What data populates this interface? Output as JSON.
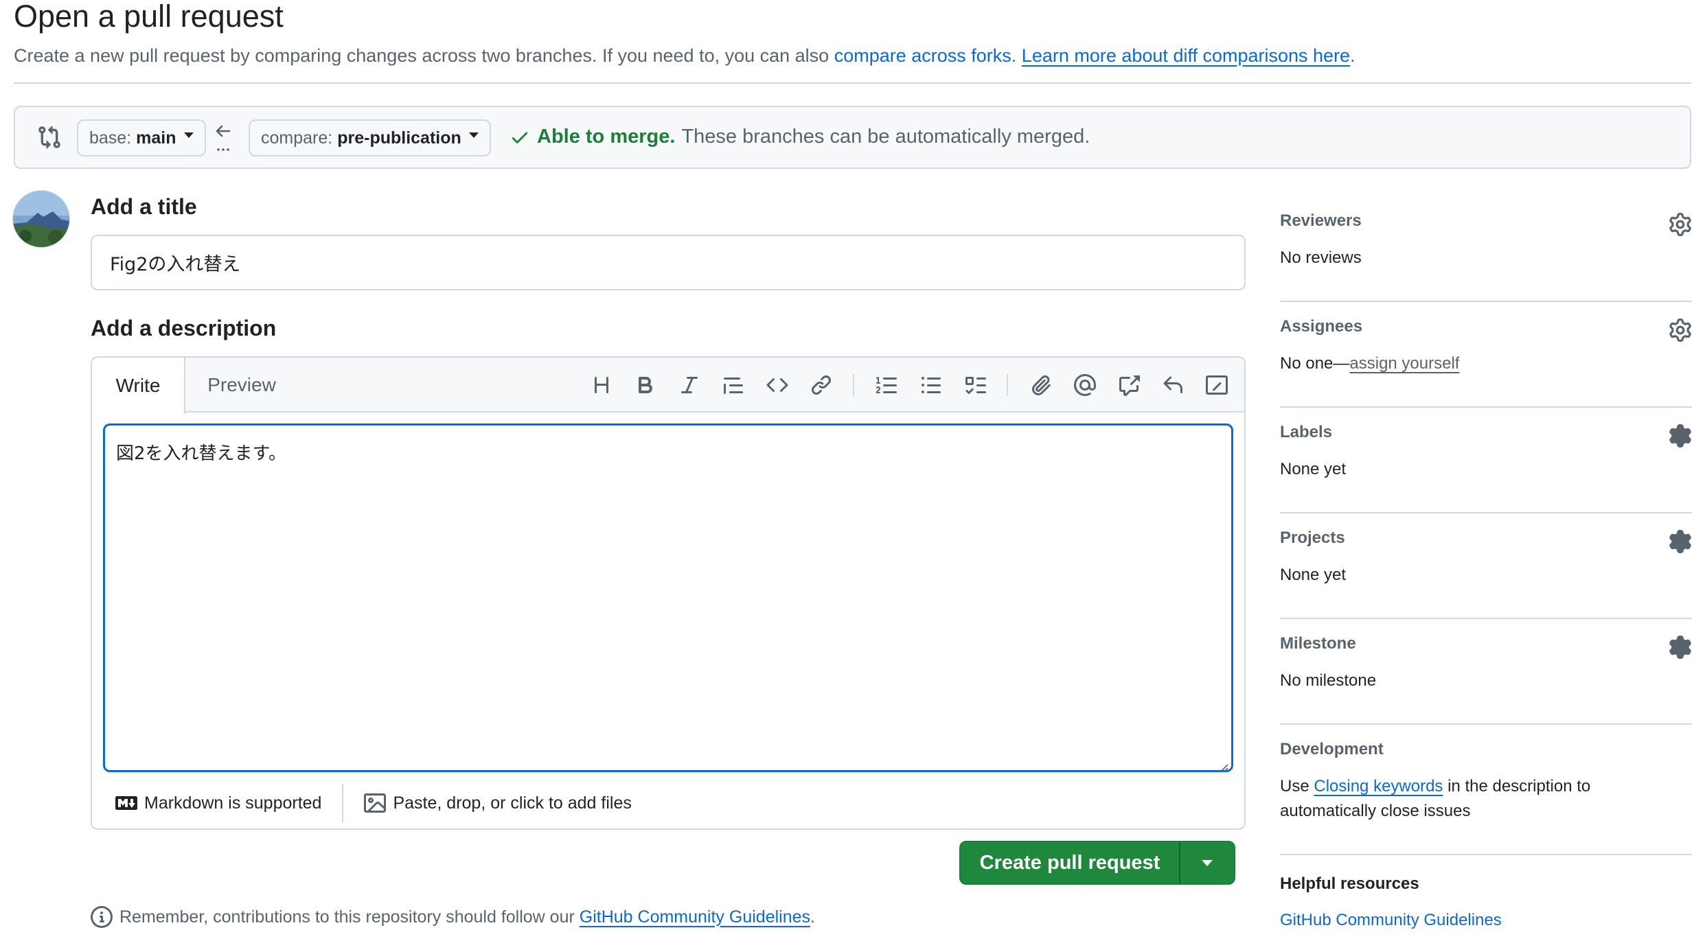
{
  "header": {
    "title": "Open a pull request",
    "subtitle_text": "Create a new pull request by comparing changes across two branches. If you need to, you can also ",
    "compare_forks_link": "compare across forks",
    "learn_more_link": "Learn more about diff comparisons here"
  },
  "compare": {
    "base_label": "base:",
    "base_value": "main",
    "compare_label": "compare:",
    "compare_value": "pre-publication",
    "merge_ok": "Able to merge.",
    "merge_msg": "These branches can be automatically merged."
  },
  "title_section": {
    "heading": "Add a title",
    "value": "Fig2の入れ替え"
  },
  "description": {
    "heading": "Add a description",
    "tab_write": "Write",
    "tab_preview": "Preview",
    "body": "図2を入れ替えます。",
    "markdown_note": "Markdown is supported",
    "files_note": "Paste, drop, or click to add files"
  },
  "toolbar_icons": [
    "heading-icon",
    "bold-icon",
    "italic-icon",
    "quote-icon",
    "code-icon",
    "link-icon",
    "ordered-list-icon",
    "unordered-list-icon",
    "task-list-icon",
    "attach-icon",
    "mention-icon",
    "cross-reference-icon",
    "reply-icon",
    "slash-commands-icon"
  ],
  "create_button": {
    "label": "Create pull request"
  },
  "footer_note": {
    "text": "Remember, contributions to this repository should follow our ",
    "link": "GitHub Community Guidelines",
    "end": "."
  },
  "sidebar": {
    "reviewers": {
      "heading": "Reviewers",
      "value": "No reviews"
    },
    "assignees": {
      "heading": "Assignees",
      "value_prefix": "No one—",
      "value_link": "assign yourself"
    },
    "labels": {
      "heading": "Labels",
      "value": "None yet"
    },
    "projects": {
      "heading": "Projects",
      "value": "None yet"
    },
    "milestone": {
      "heading": "Milestone",
      "value": "No milestone"
    },
    "development": {
      "heading": "Development",
      "text_prefix": "Use ",
      "link": "Closing keywords",
      "text_suffix": " in the description to automatically close issues"
    },
    "helpful": {
      "heading": "Helpful resources",
      "link": "GitHub Community Guidelines"
    }
  },
  "colors": {
    "accent": "#0969da",
    "success": "#1a7f37",
    "button": "#1f883d",
    "border": "#d1d9e0",
    "muted": "#59636e"
  }
}
